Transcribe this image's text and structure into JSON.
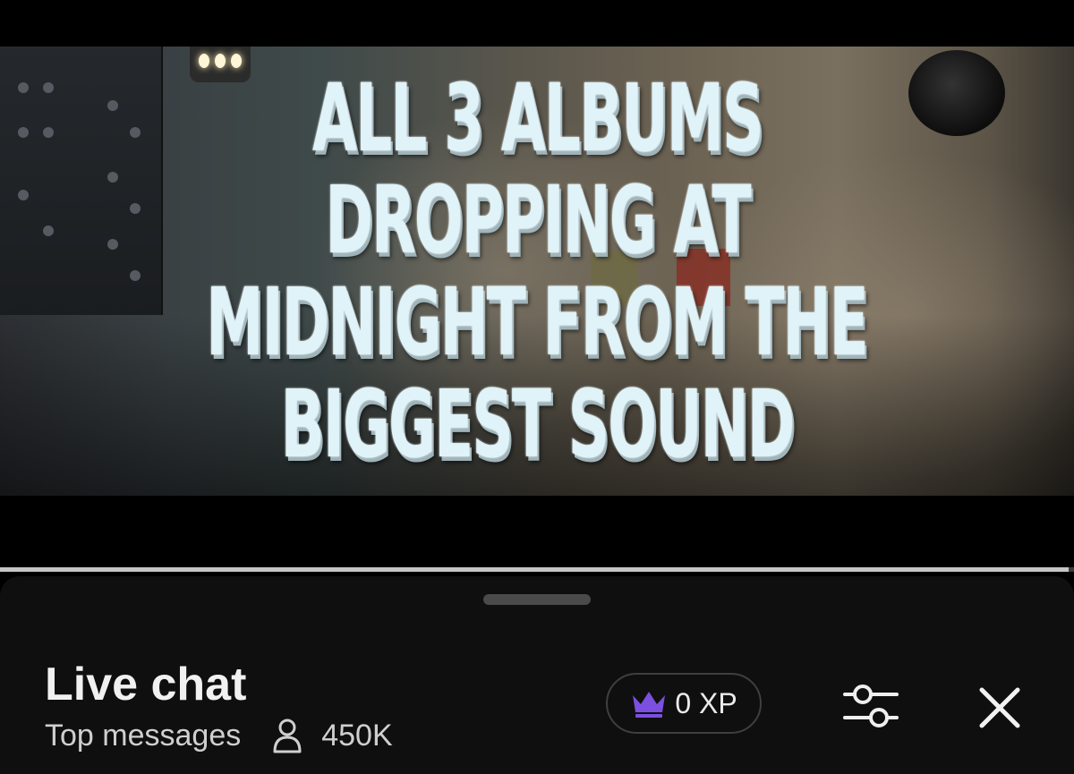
{
  "video": {
    "overlay_lines": [
      "ALL 3 ALBUMS",
      "DROPPING AT",
      "MIDNIGHT FROM THE",
      "BIGGEST SOUND"
    ],
    "buffered_fraction": 0.995
  },
  "live_chat": {
    "title": "Live chat",
    "filter": "Top messages",
    "viewer_count": "450K",
    "xp": "0 XP"
  },
  "icons": {
    "viewers": "person-icon",
    "xp": "crown-icon",
    "settings": "sliders-icon",
    "close": "close-icon"
  },
  "colors": {
    "accent_crown": "#7b4fe0",
    "sheet_bg": "#0f0f0f",
    "overlay_text": "#dff3f8"
  }
}
